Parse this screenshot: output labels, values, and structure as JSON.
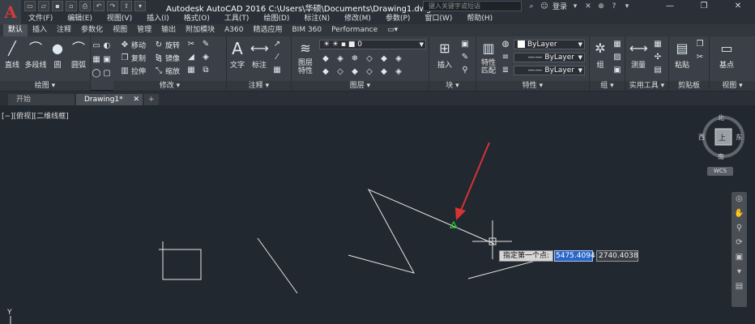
{
  "window": {
    "title": "Autodesk AutoCAD 2016    C:\\Users\\华硕\\Documents\\Drawing1.dwg",
    "search_placeholder": "键入关键字或短语",
    "login_label": "登录",
    "minimize": "—",
    "restore": "❐",
    "close": "✕"
  },
  "menu": [
    "文件(F)",
    "编辑(E)",
    "视图(V)",
    "插入(I)",
    "格式(O)",
    "工具(T)",
    "绘图(D)",
    "标注(N)",
    "修改(M)",
    "参数(P)",
    "窗口(W)",
    "帮助(H)"
  ],
  "ribbon_tabs": [
    "默认",
    "插入",
    "注释",
    "参数化",
    "视图",
    "管理",
    "输出",
    "附加模块",
    "A360",
    "精选应用",
    "BIM 360",
    "Performance"
  ],
  "ribbon": {
    "draw": {
      "label": "绘图 ▾",
      "line": "直线",
      "polyline": "多段线",
      "circle": "圆",
      "arc": "圆弧"
    },
    "modify": {
      "label": "修改 ▾",
      "move": "移动",
      "rotate": "旋转",
      "copy": "复制",
      "mirror": "镜像",
      "stretch": "拉伸",
      "scale": "缩放"
    },
    "annotation": {
      "label": "注释 ▾",
      "text": "文字",
      "dimension": "标注"
    },
    "layers": {
      "label": "图层 ▾",
      "layer_properties": "图层\n特性",
      "current_layer": "0"
    },
    "block": {
      "label": "块 ▾",
      "insert": "插入"
    },
    "properties": {
      "label": "特性 ▾",
      "match": "特性\n匹配",
      "color": "ByLayer",
      "linetype": "ByLayer",
      "lineweight": "ByLayer"
    },
    "groups": {
      "label": "组 ▾",
      "group": "组"
    },
    "utilities": {
      "label": "实用工具 ▾",
      "measure": "测量"
    },
    "clipboard": {
      "label": "剪贴板",
      "paste": "粘贴"
    },
    "view": {
      "label": "视图 ▾",
      "base": "基点"
    }
  },
  "doc_tabs": [
    "开始",
    "Drawing1*"
  ],
  "doc_tab_close": "✕",
  "doc_tab_add": "+",
  "viewport_label": "[−][俯视][二维线框]",
  "viewcube": {
    "north": "北",
    "south": "南",
    "east": "东",
    "west": "西",
    "top": "上"
  },
  "wcs_label": "WCS",
  "prompt": {
    "text": "指定第一个点:",
    "x_value": "5475.4094",
    "y_value": "2740.4038"
  },
  "ucs_y": "Y",
  "colors": {
    "canvas": "#212830",
    "ribbon": "#3b4048",
    "accent_red": "#d63333",
    "snap_green": "#2bd12b",
    "input_blue": "#2a65c8"
  }
}
